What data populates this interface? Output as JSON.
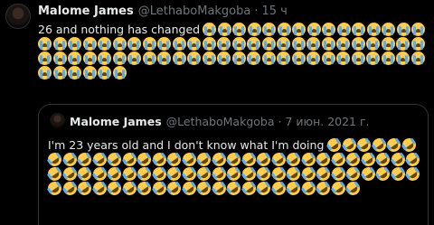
{
  "tweet": {
    "author_name": "Malome James",
    "handle": "@LethaboMakgoba",
    "separator": "·",
    "time": "15 ч",
    "text": "26 and nothing has changed",
    "emoji_icon": "loudly-crying-face-icon",
    "emoji_count": 73
  },
  "quoted_tweet": {
    "author_name": "Malome James",
    "handle": "@LethaboMakgoba",
    "separator": "·",
    "date": "7 июн. 2021 г.",
    "text": "I'm 23 years old and I don't know what I'm doing",
    "emoji_icon": "rolling-on-the-floor-laughing-icon",
    "emoji_count": 77
  },
  "colors": {
    "background": "#000000",
    "text": "#e7e9ea",
    "secondary_text": "#71767b",
    "border": "#2f3336",
    "emoji_face": "#ffcc4d",
    "emoji_tears": "#5dadec"
  }
}
